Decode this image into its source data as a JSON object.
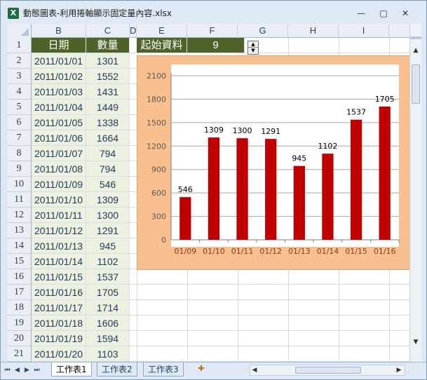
{
  "window": {
    "title": "動態圖表-利用捲軸顯示固定量內容.xlsx",
    "app_icon": "X",
    "minimize": "—",
    "maximize": "□",
    "close": "✕"
  },
  "columns": [
    "B",
    "C",
    "D",
    "E",
    "F",
    "G",
    "H",
    "I"
  ],
  "rows": [
    "1",
    "2",
    "3",
    "4",
    "5",
    "6",
    "7",
    "8",
    "9",
    "10",
    "11",
    "12",
    "13",
    "14",
    "15",
    "16",
    "17",
    "18",
    "19",
    "20",
    "21"
  ],
  "table": {
    "date_header": "日期",
    "qty_header": "數量",
    "records": [
      {
        "date": "2011/01/01",
        "qty": "1301"
      },
      {
        "date": "2011/01/02",
        "qty": "1552"
      },
      {
        "date": "2011/01/03",
        "qty": "1431"
      },
      {
        "date": "2011/01/04",
        "qty": "1449"
      },
      {
        "date": "2011/01/05",
        "qty": "1338"
      },
      {
        "date": "2011/01/06",
        "qty": "1664"
      },
      {
        "date": "2011/01/07",
        "qty": "794"
      },
      {
        "date": "2011/01/08",
        "qty": "794"
      },
      {
        "date": "2011/01/09",
        "qty": "546"
      },
      {
        "date": "2011/01/10",
        "qty": "1309"
      },
      {
        "date": "2011/01/11",
        "qty": "1300"
      },
      {
        "date": "2011/01/12",
        "qty": "1291"
      },
      {
        "date": "2011/01/13",
        "qty": "945"
      },
      {
        "date": "2011/01/14",
        "qty": "1102"
      },
      {
        "date": "2011/01/15",
        "qty": "1537"
      },
      {
        "date": "2011/01/16",
        "qty": "1705"
      },
      {
        "date": "2011/01/17",
        "qty": "1714"
      },
      {
        "date": "2011/01/18",
        "qty": "1606"
      },
      {
        "date": "2011/01/19",
        "qty": "1594"
      },
      {
        "date": "2011/01/20",
        "qty": "1103"
      }
    ]
  },
  "control": {
    "label": "起始資料",
    "value": "9",
    "spin_up": "▲",
    "spin_down": "▼"
  },
  "chart_data": {
    "type": "bar",
    "categories": [
      "01/09",
      "01/10",
      "01/11",
      "01/12",
      "01/13",
      "01/14",
      "01/15",
      "01/16"
    ],
    "values": [
      546,
      1309,
      1300,
      1291,
      945,
      1102,
      1537,
      1705
    ],
    "ylim": [
      0,
      2100
    ],
    "yticks": [
      0,
      300,
      600,
      900,
      1200,
      1500,
      1800,
      2100
    ],
    "data_labels": true,
    "grid": true,
    "legend": "none",
    "bar_color": "#c00000",
    "frame_color": "#fabf8f"
  },
  "sheets": {
    "tabs": [
      "工作表1",
      "工作表2",
      "工作表3"
    ],
    "active": "工作表1",
    "nav": [
      "⏮",
      "◀",
      "▶",
      "⏭"
    ]
  },
  "colors": {
    "header_fill": "#4f6228",
    "data_fill": "#ebf1de"
  }
}
